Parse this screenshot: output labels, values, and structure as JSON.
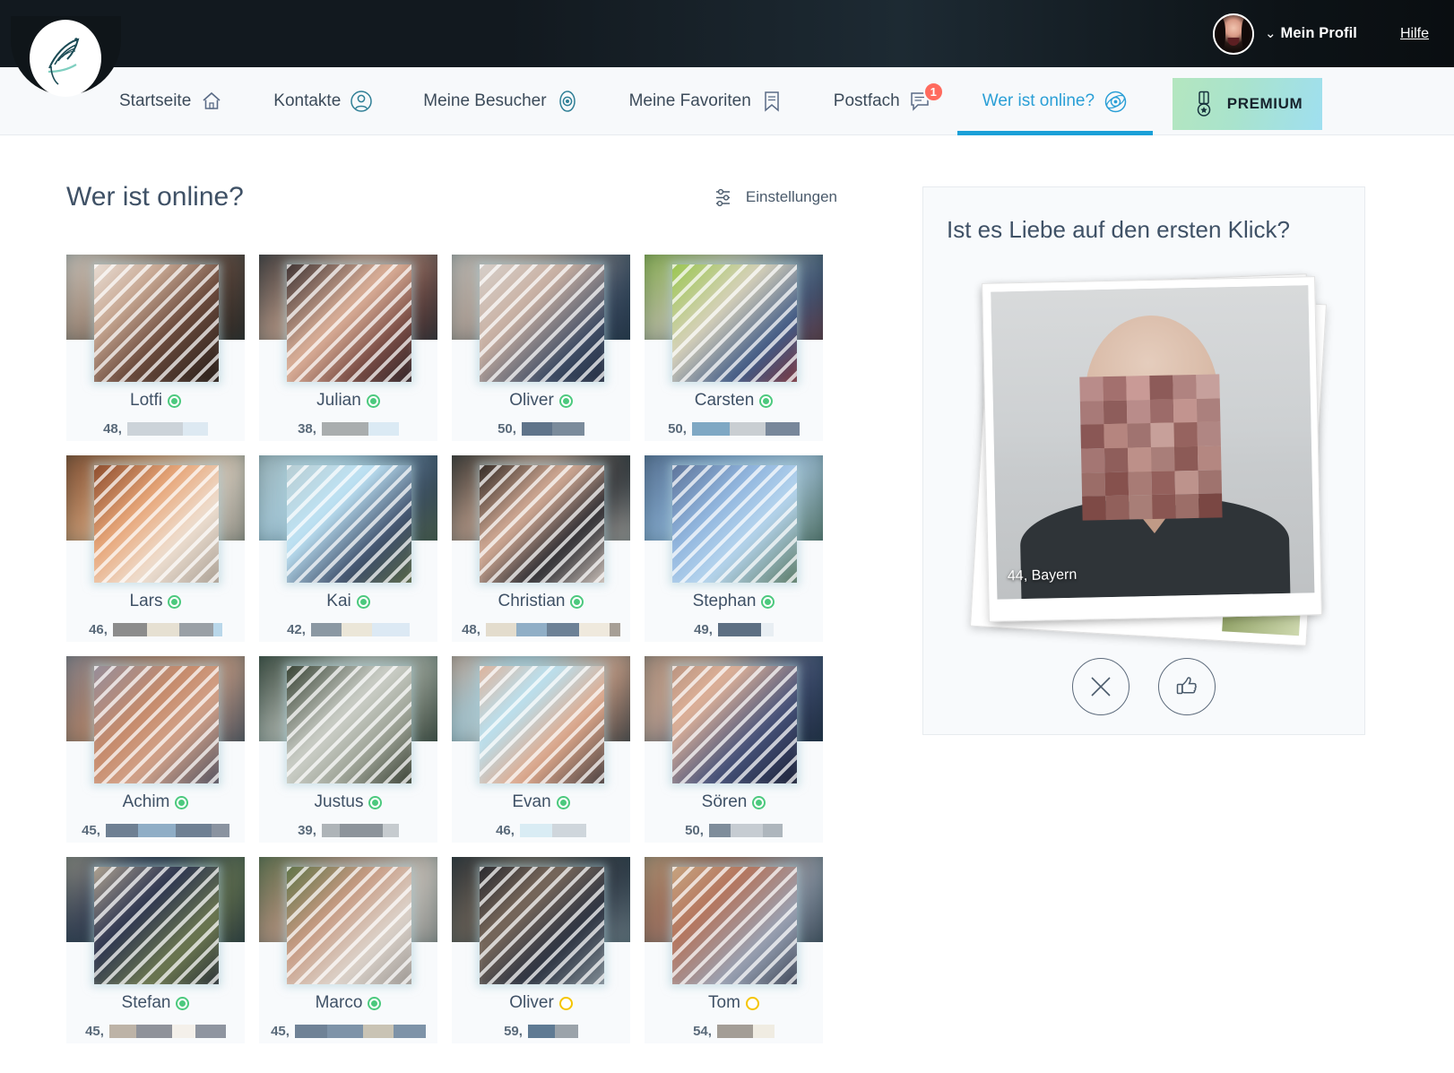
{
  "topbar": {
    "avatar_name": "avatar",
    "chevron": "⌄",
    "profile_label": "Mein Profil",
    "help_label": "Hilfe"
  },
  "nav": {
    "items": [
      {
        "label": "Startseite",
        "icon": "home-icon",
        "active": false,
        "badge": ""
      },
      {
        "label": "Kontakte",
        "icon": "person-icon",
        "active": false,
        "badge": ""
      },
      {
        "label": "Meine Besucher",
        "icon": "eye-icon",
        "active": false,
        "badge": ""
      },
      {
        "label": "Meine Favoriten",
        "icon": "bookmark-icon",
        "active": false,
        "badge": ""
      },
      {
        "label": "Postfach",
        "icon": "message-icon",
        "active": false,
        "badge": "1"
      },
      {
        "label": "Wer ist online?",
        "icon": "radar-icon",
        "active": true,
        "badge": ""
      }
    ],
    "premium_label": "PREMIUM",
    "premium_icon": "medal-icon"
  },
  "main": {
    "page_title": "Wer ist online?",
    "settings_label": "Einstellungen",
    "settings_icon": "sliders-icon"
  },
  "colors": {
    "accent": "#1aa0d8",
    "online": "#4cc97e",
    "away": "#f5c400",
    "badge": "#ff6b5e",
    "card_band": "#153e42",
    "premium_from": "#b4e6bf",
    "premium_to": "#9fdff0"
  },
  "profiles": [
    {
      "name": "Lotfi",
      "age": "48",
      "status": "online",
      "location_redacted": true,
      "redact_widths": [
        62,
        28
      ],
      "redact_colors": [
        "#ccd3d9",
        "#dde9f2"
      ],
      "band": "#1a3d44",
      "photo": "linear-gradient(135deg,#f2ece6 0%,#c7a792 32%,#6b4a3c 58%,#1b1714 100%)"
    },
    {
      "name": "Julian",
      "age": "38",
      "status": "online",
      "location_redacted": true,
      "redact_widths": [
        52,
        34
      ],
      "redact_colors": [
        "#a9adae",
        "#dbeaf4"
      ],
      "band": "#16373e",
      "photo": "linear-gradient(135deg,#241e22 0%,#e0b49c 45%,#7a4c44 70%,#1c1a22 100%)"
    },
    {
      "name": "Oliver",
      "age": "50",
      "status": "online",
      "location_redacted": true,
      "redact_widths": [
        34,
        36
      ],
      "redact_colors": [
        "#60748a",
        "#7b8b9b"
      ],
      "band": "#15373d",
      "photo": "linear-gradient(135deg,#d9d6d2 0%,#c9b0a2 38%,#3b4a63 72%,#20283a 100%)"
    },
    {
      "name": "Carsten",
      "age": "50",
      "status": "online",
      "location_redacted": true,
      "redact_widths": [
        42,
        40,
        38
      ],
      "redact_colors": [
        "#7fa8c4",
        "#c9ced2",
        "#78879a"
      ],
      "band": "#14332e",
      "photo": "linear-gradient(135deg,#8fc43c 0%,#d8d2bc 40%,#3f5a86 70%,#8a2f2f 100%)"
    },
    {
      "name": "Lars",
      "age": "46",
      "status": "online",
      "location_redacted": true,
      "redact_widths": [
        38,
        36,
        38,
        10
      ],
      "redact_colors": [
        "#8c8c8c",
        "#e6e0d2",
        "#9aa0a6",
        "#b9d7ea"
      ],
      "band": "#12332f",
      "photo": "linear-gradient(135deg,#7a3a1e 0%,#e8a678 38%,#efe0d2 64%,#9b9287 100%)"
    },
    {
      "name": "Kai",
      "age": "42",
      "status": "online",
      "location_redacted": true,
      "redact_widths": [
        34,
        34,
        42
      ],
      "redact_colors": [
        "#8b98a3",
        "#ebe6d8",
        "#dce9f4"
      ],
      "band": "#17373c",
      "photo": "linear-gradient(135deg,#b7c9cc 0%,#bfe4f6 38%,#3d4e6a 68%,#5d6b3c 100%)"
    },
    {
      "name": "Christian",
      "age": "48",
      "status": "online",
      "location_redacted": true,
      "redact_widths": [
        34,
        34,
        36,
        34,
        12
      ],
      "redact_colors": [
        "#e3dccd",
        "#90aec6",
        "#6d8196",
        "#efe9dd",
        "#a79f96"
      ],
      "band": "#16363c",
      "photo": "linear-gradient(135deg,#14110f 0%,#d9b09a 40%,#2b2b30 66%,#efe2d8 100%)"
    },
    {
      "name": "Stephan",
      "age": "49",
      "status": "online",
      "location_redacted": true,
      "redact_widths": [
        48,
        14
      ],
      "redact_colors": [
        "#5d6f83",
        "#e8eef3"
      ],
      "band": "#193c44",
      "photo": "linear-gradient(135deg,#54678c 0%,#8fb4dd 36%,#b7d6ef 60%,#4a6a4e 100%)"
    },
    {
      "name": "Achim",
      "age": "45",
      "status": "online",
      "location_redacted": true,
      "redact_widths": [
        36,
        42,
        40,
        20
      ],
      "redact_colors": [
        "#6f8093",
        "#8fadc6",
        "#6f8093",
        "#8a93a0"
      ],
      "band": "#183a3f",
      "photo": "linear-gradient(135deg,#8d8fa4 0%,#c68a6a 40%,#d3a38a 62%,#3b4358 100%)"
    },
    {
      "name": "Justus",
      "age": "39",
      "status": "online",
      "location_redacted": true,
      "redact_widths": [
        20,
        48,
        18
      ],
      "redact_colors": [
        "#aeb4b8",
        "#8d949b",
        "#c6cbcf"
      ],
      "band": "#1a3c3c",
      "photo": "linear-gradient(135deg,#1d2a1a 0%,#cfd2cb 44%,#9aa093 68%,#222a1e 100%)"
    },
    {
      "name": "Evan",
      "age": "46",
      "status": "online",
      "location_redacted": true,
      "redact_widths": [
        36,
        38
      ],
      "redact_colors": [
        "#d9ecf4",
        "#cfd6dc"
      ],
      "band": "#19393f",
      "photo": "linear-gradient(135deg,#e8a887 0%,#b8e2f2 34%,#e0a98c 62%,#2a2a30 100%)"
    },
    {
      "name": "Sören",
      "age": "50",
      "status": "online",
      "location_redacted": true,
      "redact_widths": [
        24,
        36,
        22
      ],
      "redact_colors": [
        "#7f8d9b",
        "#c6ccd2",
        "#aeb6bd"
      ],
      "band": "#173b41",
      "photo": "linear-gradient(135deg,#b08c7a 0%,#e0b39a 30%,#46527a 62%,#141a2c 100%)"
    },
    {
      "name": "Stefan",
      "age": "45",
      "status": "online",
      "location_redacted": true,
      "redact_widths": [
        30,
        40,
        26,
        34
      ],
      "redact_colors": [
        "#bdb3a7",
        "#8f929a",
        "#f4f0ea",
        "#8f95a0"
      ],
      "band": "#16383e",
      "photo": "linear-gradient(135deg,#cbbba0 0%,#2c3450 38%,#6e7a50 68%,#1b2233 100%)"
    },
    {
      "name": "Marco",
      "age": "45",
      "status": "online",
      "location_redacted": true,
      "redact_widths": [
        36,
        40,
        34,
        36
      ],
      "redact_colors": [
        "#6f8296",
        "#7e93a8",
        "#c9c3b4",
        "#7e93a8"
      ],
      "band": "#1a3c40",
      "photo": "linear-gradient(135deg,#4a6d3c 0%,#c79a82 38%,#ddd4cc 66%,#8e8a86 100%)"
    },
    {
      "name": "Oliver",
      "age": "59",
      "status": "away",
      "location_redacted": true,
      "redact_widths": [
        30,
        26
      ],
      "redact_colors": [
        "#5f7a93",
        "#9ba3aa"
      ],
      "band": "#17383e",
      "photo": "linear-gradient(135deg,#181c26 0%,#7b6a5c 36%,#2b3240 64%,#93a0a8 100%)"
    },
    {
      "name": "Tom",
      "age": "54",
      "status": "away",
      "location_redacted": true,
      "redact_widths": [
        40,
        24
      ],
      "redact_colors": [
        "#a39d96",
        "#f0ece2"
      ],
      "band": "#1a3b3d",
      "photo": "linear-gradient(135deg,#cbb089 0%,#b4745c 34%,#9aa3b5 66%,#2b3344 100%)"
    }
  ],
  "side_panel": {
    "title": "Ist es Liebe auf den ersten Klick?",
    "photo_caption": "44, Bayern",
    "reject_icon": "close-x-icon",
    "like_icon": "thumbs-up-icon"
  }
}
